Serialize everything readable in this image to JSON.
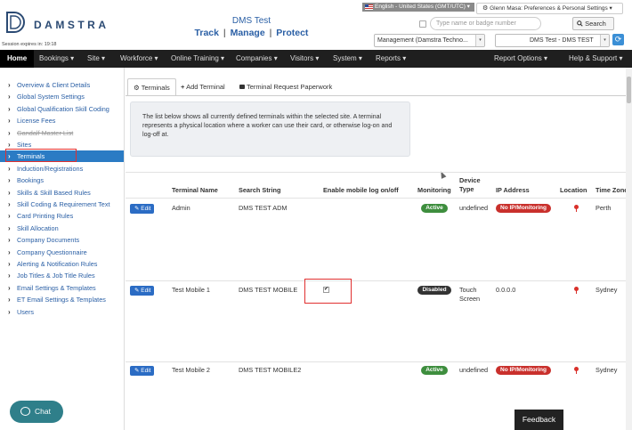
{
  "header": {
    "logo_text": "DAMSTRA",
    "session_text": "Session expires in:  19:18",
    "app_title": "DMS Test",
    "tagline": [
      "Track",
      "Manage",
      "Protect"
    ],
    "tagline_sep": "|",
    "language": "English - United States (GMT/UTC)",
    "user_menu": "Glenn Masa: Preferences & Personal Settings",
    "search_placeholder": "Type name or badge number",
    "search_button": "Search",
    "company_select": "Management (Damstra Techno...",
    "site_select": "DMS Test - DMS TEST"
  },
  "nav": {
    "items": [
      "Home",
      "Bookings",
      "Site",
      "Workforce",
      "Online Training",
      "Companies",
      "Visitors",
      "System",
      "Reports"
    ],
    "right_items": [
      "Report Options",
      "Help & Support"
    ],
    "dropdown_marker": "▾"
  },
  "sidebar": {
    "items": [
      "Overview & Client Details",
      "Global System Settings",
      "Global Qualification Skill Coding",
      "License Fees",
      "Gandalf Master List",
      "Sites",
      "Terminals",
      "Induction/Registrations",
      "Bookings",
      "Skills & Skill Based Rules",
      "Skill Coding & Requirement Text",
      "Card Printing Rules",
      "Skill Allocation",
      "Company Documents",
      "Company Questionnaire",
      "Alerting & Notification Rules",
      "Job Titles & Job Title Rules",
      "Email Settings & Templates",
      "ET Email Settings & Templates",
      "Users"
    ],
    "active_index": 6,
    "strikethrough_index": 4
  },
  "chat_label": "Chat",
  "tabs": [
    "Terminals",
    "Add Terminal",
    "Terminal Request Paperwork"
  ],
  "info_text": "The list below shows all currently defined terminals within the selected site. A terminal represents a physical location where a worker can use their card, or otherwise log-on and log-off at.",
  "table": {
    "headers": [
      "Terminal Name",
      "Search String",
      "Enable mobile log on/off",
      "Monitoring",
      "Device Type",
      "IP Address",
      "Location",
      "Time Zone"
    ],
    "edit_label": "Edit",
    "rows": [
      {
        "name": "Admin",
        "search": "DMS TEST ADM",
        "mobile": false,
        "monitoring": "Active",
        "device": "undefined",
        "ip": "No IP/Monitoring",
        "timezone": "Perth"
      },
      {
        "name": "Test Mobile 1",
        "search": "DMS TEST MOBILE",
        "mobile": true,
        "monitoring": "Disabled",
        "device": "Touch Screen",
        "ip": "0.0.0.0",
        "timezone": "Sydney"
      },
      {
        "name": "Test Mobile 2",
        "search": "DMS TEST MOBILE2",
        "mobile": false,
        "monitoring": "Active",
        "device": "undefined",
        "ip": "No IP/Monitoring",
        "timezone": "Sydney"
      }
    ]
  },
  "feedback_label": "Feedback",
  "colors": {
    "nav_bg": "#1f1f1f",
    "link_blue": "#2a5fa5",
    "active_blue": "#2b7bc4",
    "badge_active": "#3e8e3e",
    "badge_noip": "#c9302c",
    "highlight_red": "#e03030"
  },
  "icons": {
    "logo": "damstra-logo-icon",
    "search": "search-icon",
    "gear": "gear-icon",
    "refresh": "refresh-icon",
    "plus": "plus-icon",
    "comment": "comment-icon",
    "pencil": "pencil-icon",
    "map_pin": "map-pin-icon",
    "chevron": "chevron-right-icon",
    "chat": "chat-bubble-icon"
  }
}
